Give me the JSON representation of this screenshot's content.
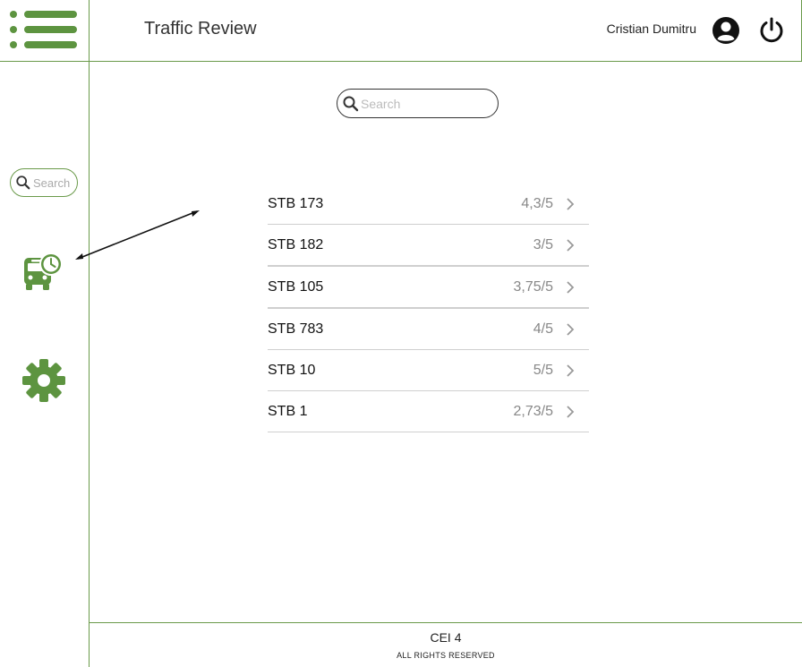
{
  "header": {
    "app_title": "Traffic Review",
    "user_name": "Cristian Dumitru"
  },
  "sidebar": {
    "search_placeholder": "Search"
  },
  "main": {
    "search_placeholder": "Search",
    "vehicles": [
      {
        "name": "STB 173",
        "rating": "4,3/5"
      },
      {
        "name": "STB 182",
        "rating": "3/5"
      },
      {
        "name": "STB 105",
        "rating": "3,75/5"
      },
      {
        "name": "STB 783",
        "rating": "4/5"
      },
      {
        "name": "STB 10",
        "rating": "5/5"
      },
      {
        "name": "STB 1",
        "rating": "2,73/5"
      }
    ]
  },
  "footer": {
    "code": "CEI 4",
    "rights": "ALL RIGHTS RESERVED"
  },
  "colors": {
    "accent": "#5d9440",
    "border": "#6a9a4a"
  },
  "icons": [
    "menu-icon",
    "user-avatar-icon",
    "power-icon",
    "search-icon",
    "bus-clock-icon",
    "gear-icon",
    "chevron-right-icon"
  ]
}
